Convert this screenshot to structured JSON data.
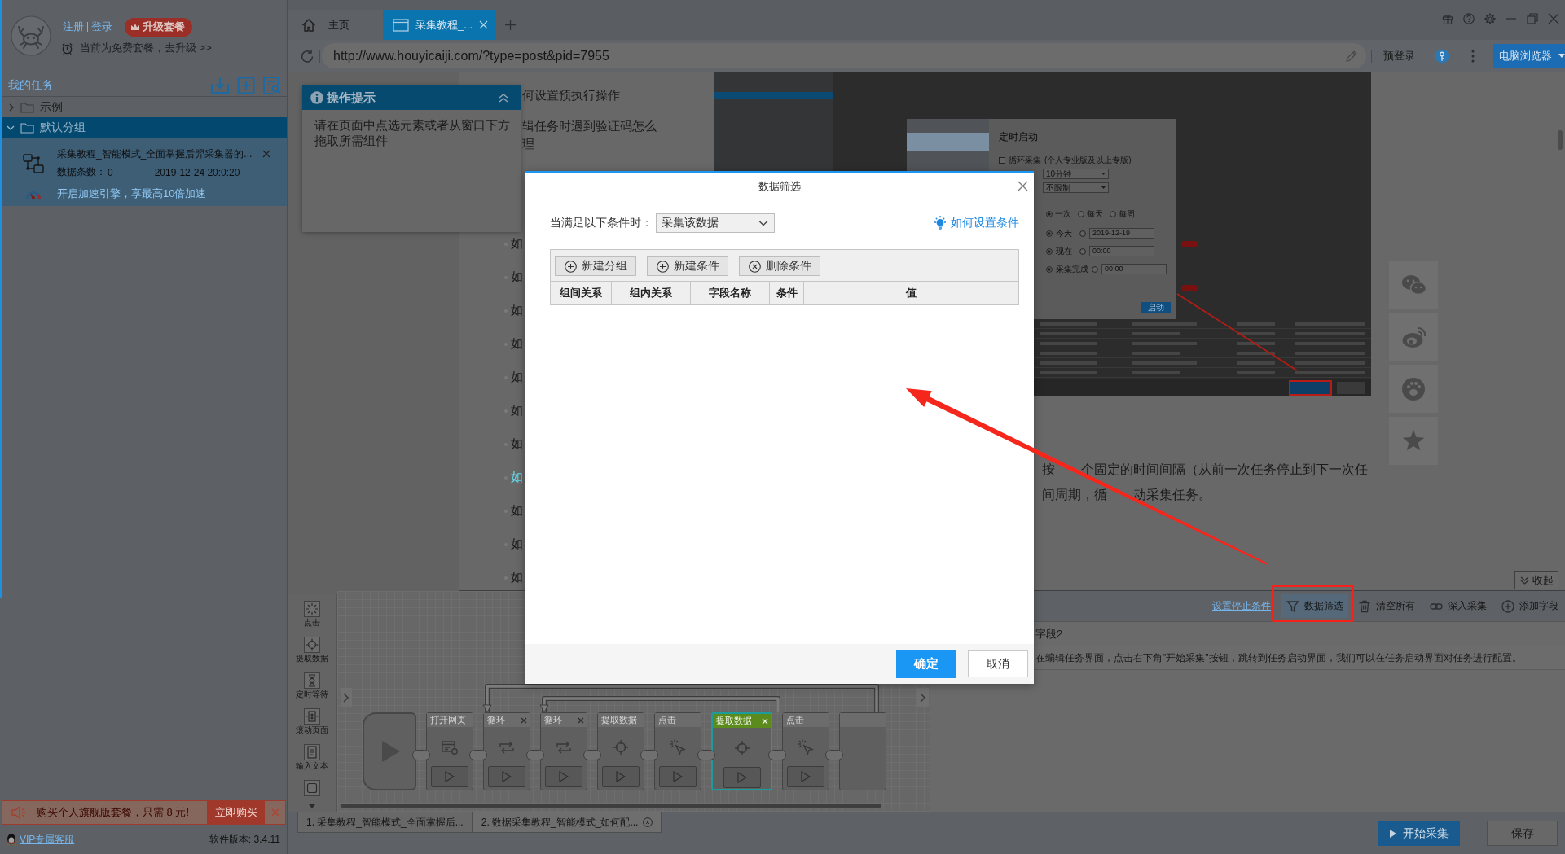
{
  "account": {
    "links": [
      "注册",
      "登录"
    ],
    "upgrade_badge": "升级套餐",
    "plan_note": "当前为免费套餐，去升级 >>"
  },
  "task_panel": {
    "title": "我的任务",
    "groups": [
      {
        "label": "示例",
        "expanded": false,
        "selected": false
      },
      {
        "label": "默认分组",
        "expanded": true,
        "selected": true,
        "children": [
          {
            "title": "采集教程_智能模式_全面掌握后羿采集器的...",
            "count_label": "数据条数：",
            "count": "0",
            "time": "2019-12-24 20:0:20",
            "boost": "开启加速引擎，享最高10倍加速"
          }
        ]
      }
    ]
  },
  "promo": {
    "text": "购买个人旗舰版套餐，只需 8 元!",
    "button": "立即购买"
  },
  "footer": {
    "support_link": "VIP专属客服",
    "version": "软件版本: 3.4.11"
  },
  "browser": {
    "tabs": [
      {
        "kind": "home",
        "label": "主页",
        "selected": false
      },
      {
        "kind": "page",
        "label": "采集教程_...",
        "selected": true
      }
    ],
    "url": "http://www.houyicaiji.com/?type=post&pid=7955",
    "prelogin": "预登录",
    "mode_button": "电脑浏览器"
  },
  "tip_popup": {
    "title": "操作提示",
    "text": "请在页面中点选元素或者从窗口下方拖取所需组件"
  },
  "web_page": {
    "intro_links": [
      {
        "lines": [
          "何设置预执行操作"
        ]
      },
      {
        "lines": [
          "辑任务时遇到验证码怎么",
          "理"
        ]
      }
    ],
    "article_links": [
      {
        "text": "如",
        "selected": false
      },
      {
        "text": "如",
        "selected": false
      },
      {
        "text": "如",
        "selected": false
      },
      {
        "text": "如",
        "selected": false
      },
      {
        "text": "如",
        "selected": false
      },
      {
        "text": "如",
        "selected": false
      },
      {
        "text": "如",
        "selected": false
      },
      {
        "text": "如",
        "selected": true
      },
      {
        "text": "如",
        "selected": false
      },
      {
        "text": "如",
        "selected": false
      },
      {
        "text": "如",
        "selected": false
      }
    ],
    "screenshot": {
      "dialog_title": "定时启动",
      "loop_option": {
        "label": "循环采集",
        "note": "(个人专业版及以上专版)",
        "checked": false
      },
      "selects": [
        "10分钟",
        "不限制"
      ],
      "frequency": [
        {
          "label": "一次",
          "selected": true
        },
        {
          "label": "每天",
          "selected": false
        },
        {
          "label": "每周",
          "selected": false
        }
      ],
      "start_rows": [
        {
          "label": "今天",
          "value": "2019-12-19",
          "selected": true
        },
        {
          "label": "现在",
          "value": "00:00",
          "selected": true
        },
        {
          "label": "采集完成",
          "value": "00:00",
          "selected": true
        }
      ],
      "start_button": "启动"
    },
    "paragraph_lines": [
      {
        "fragments": [
          "按",
          "个固定的时间间隔（从前一次任务停止到下一次任"
        ]
      },
      {
        "fragments": [
          "间周期，循",
          "动采集任务。"
        ]
      }
    ],
    "collapse_button": "收起"
  },
  "bottom_panel": {
    "palette": [
      {
        "kind": "click",
        "label": "点击"
      },
      {
        "kind": "extract",
        "label": "提取数据"
      },
      {
        "kind": "wait",
        "label": "定时等待"
      },
      {
        "kind": "scroll",
        "label": "滚动页面"
      },
      {
        "kind": "input",
        "label": "输入文本"
      },
      {
        "kind": "frame"
      }
    ],
    "flow": [
      {
        "kind": "open_page",
        "label": "打开网页",
        "selected": false,
        "closable": false
      },
      {
        "kind": "loop",
        "label": "循环",
        "selected": false,
        "closable": true
      },
      {
        "kind": "loop",
        "label": "循环",
        "selected": false,
        "closable": true
      },
      {
        "kind": "extract",
        "label": "提取数据",
        "selected": false,
        "closable": false
      },
      {
        "kind": "click",
        "label": "点击",
        "selected": false,
        "closable": false
      },
      {
        "kind": "extract",
        "label": "提取数据",
        "selected": true,
        "closable": true
      },
      {
        "kind": "click",
        "label": "点击",
        "selected": false,
        "closable": false
      },
      {
        "kind": "blank",
        "selected": false,
        "closable": false
      }
    ],
    "stop_condition_link": "设置停止条件",
    "tools": [
      {
        "kind": "filter",
        "label": "数据筛选",
        "selected": true
      },
      {
        "kind": "clear",
        "label": "清空所有",
        "selected": false
      },
      {
        "kind": "deep",
        "label": "深入采集",
        "selected": false
      },
      {
        "kind": "add",
        "label": "添加字段",
        "selected": false
      }
    ],
    "field_column": "字段2",
    "field_value": "在编辑任务界面，点击右下角\"开始采集\"按钮，跳转到任务启动界面，我们可以在任务启动界面对任务进行配置。",
    "task_tabs": [
      {
        "label": "1. 采集教程_智能模式_全面掌握后...",
        "selected": false
      },
      {
        "label": "2. 数据采集教程_智能模式_如何配...",
        "selected": true
      }
    ],
    "start_button": "开始采集",
    "save_button": "保存"
  },
  "dialog": {
    "title": "数据筛选",
    "condition_label": "当满足以下条件时：",
    "condition_select": "采集该数据",
    "help_link": "如何设置条件",
    "tools": [
      {
        "kind": "add",
        "label": "新建分组"
      },
      {
        "kind": "add",
        "label": "新建条件"
      },
      {
        "kind": "remove",
        "label": "删除条件"
      }
    ],
    "columns": [
      "组间关系",
      "组内关系",
      "字段名称",
      "条件",
      "值"
    ],
    "confirm": "确定",
    "cancel": "取消"
  }
}
